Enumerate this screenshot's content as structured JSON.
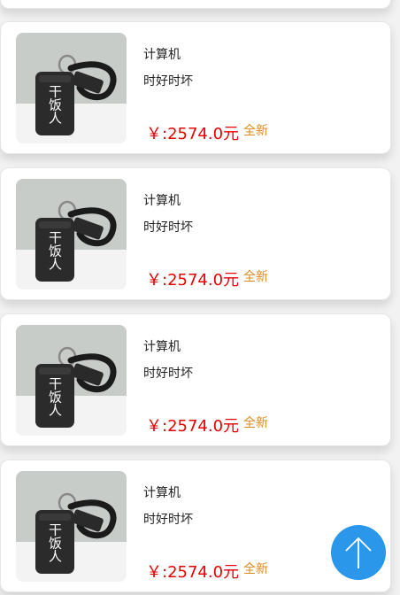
{
  "products": [
    {
      "name": "计算机",
      "description": "时好时坏",
      "price": "￥:2574.0元",
      "condition": "全新"
    },
    {
      "name": "计算机",
      "description": "时好时坏",
      "price": "￥:2574.0元",
      "condition": "全新"
    },
    {
      "name": "计算机",
      "description": "时好时坏",
      "price": "￥:2574.0元",
      "condition": "全新"
    },
    {
      "name": "计算机",
      "description": "时好时坏",
      "price": "￥:2574.0元",
      "condition": "全新"
    }
  ],
  "thumbnail_text": "干饭人",
  "colors": {
    "price": "#e60000",
    "condition": "#e08a1e",
    "fab": "#2b97ea"
  },
  "icons": {
    "fab": "arrow-up-icon"
  }
}
